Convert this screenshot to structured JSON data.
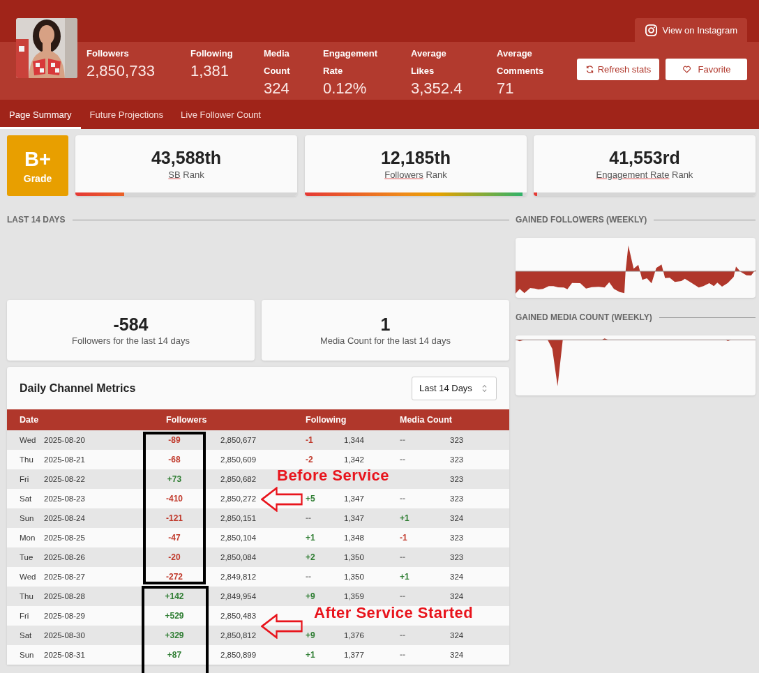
{
  "stats": [
    {
      "label": "Followers",
      "value": "2,850,733"
    },
    {
      "label": "Following",
      "value": "1,381"
    },
    {
      "label": "Media Count",
      "value": "324"
    },
    {
      "label": "Engagement Rate",
      "value": "0.12%"
    },
    {
      "label": "Average Likes",
      "value": "3,352.4"
    },
    {
      "label": "Average Comments",
      "value": "71"
    }
  ],
  "view_button": "View on Instagram",
  "buttons": [
    {
      "kind": "refresh",
      "label": "Refresh stats"
    },
    {
      "kind": "favorite",
      "label": "Favorite"
    }
  ],
  "tabs": [
    {
      "label": "Page Summary",
      "selected": true
    },
    {
      "label": "Future Projections",
      "selected": false
    },
    {
      "label": "Live Follower Count",
      "selected": false
    }
  ],
  "grade": {
    "value": "B+",
    "label": "Grade"
  },
  "ranks": [
    {
      "value": "43,588th",
      "term": "SB",
      "suffix": "Rank",
      "level": 0.22
    },
    {
      "value": "12,185th",
      "term": "Followers",
      "suffix": "Rank",
      "level": 0.98
    },
    {
      "value": "41,553rd",
      "term": "Engagement Rate",
      "suffix": "Rank",
      "level": 0.015
    }
  ],
  "last_14_days": {
    "title": "LAST 14 DAYS",
    "summaries": [
      {
        "value": "-584",
        "label": "Followers for the last 14 days"
      },
      {
        "value": "1",
        "label": "Media Count for the last 14 days"
      }
    ]
  },
  "metrics": {
    "title": "Daily Channel Metrics",
    "range": "Last 14 Days",
    "columns": [
      "Date",
      "Followers",
      "Following",
      "Media Count"
    ],
    "rows": [
      {
        "day": "Wed",
        "date": "2025-08-20",
        "followers": {
          "change": "-89",
          "color": "#c0392b",
          "total": "2,850,677"
        },
        "following": {
          "change": "-1",
          "color": "#c0392b",
          "total": "1,344"
        },
        "media_count": {
          "change": "--",
          "color": "#8a8a8a",
          "total": "323"
        }
      },
      {
        "day": "Thu",
        "date": "2025-08-21",
        "followers": {
          "change": "-68",
          "color": "#c0392b",
          "total": "2,850,609"
        },
        "following": {
          "change": "-2",
          "color": "#c0392b",
          "total": "1,342"
        },
        "media_count": {
          "change": "--",
          "color": "#8a8a8a",
          "total": "323"
        }
      },
      {
        "day": "Fri",
        "date": "2025-08-22",
        "followers": {
          "change": "+73",
          "color": "#2e7d32",
          "total": "2,850,682"
        },
        "media_count": {
          "total": "323"
        }
      },
      {
        "day": "Sat",
        "date": "2025-08-23",
        "followers": {
          "change": "-410",
          "color": "#c0392b",
          "total": "2,850,272"
        },
        "following": {
          "change": "+5",
          "color": "#2e7d32",
          "total": "1,347"
        },
        "media_count": {
          "change": "--",
          "color": "#8a8a8a",
          "total": "323"
        }
      },
      {
        "day": "Sun",
        "date": "2025-08-24",
        "followers": {
          "change": "-121",
          "color": "#c0392b",
          "total": "2,850,151"
        },
        "following": {
          "change": "--",
          "color": "#8a8a8a",
          "total": "1,347"
        },
        "media_count": {
          "change": "+1",
          "color": "#2e7d32",
          "total": "324"
        }
      },
      {
        "day": "Mon",
        "date": "2025-08-25",
        "followers": {
          "change": "-47",
          "color": "#c0392b",
          "total": "2,850,104"
        },
        "following": {
          "change": "+1",
          "color": "#2e7d32",
          "total": "1,348"
        },
        "media_count": {
          "change": "-1",
          "color": "#c0392b",
          "total": "323"
        }
      },
      {
        "day": "Tue",
        "date": "2025-08-26",
        "followers": {
          "change": "-20",
          "color": "#c0392b",
          "total": "2,850,084"
        },
        "following": {
          "change": "+2",
          "color": "#2e7d32",
          "total": "1,350"
        },
        "media_count": {
          "change": "--",
          "color": "#8a8a8a",
          "total": "323"
        }
      },
      {
        "day": "Wed",
        "date": "2025-08-27",
        "followers": {
          "change": "-272",
          "color": "#c0392b",
          "total": "2,849,812"
        },
        "following": {
          "change": "--",
          "color": "#8a8a8a",
          "total": "1,350"
        },
        "media_count": {
          "change": "+1",
          "color": "#2e7d32",
          "total": "324"
        }
      },
      {
        "day": "Thu",
        "date": "2025-08-28",
        "followers": {
          "change": "+142",
          "color": "#2e7d32",
          "total": "2,849,954"
        },
        "following": {
          "change": "+9",
          "color": "#2e7d32",
          "total": "1,359"
        },
        "media_count": {
          "change": "--",
          "color": "#8a8a8a",
          "total": "324"
        }
      },
      {
        "day": "Fri",
        "date": "2025-08-29",
        "followers": {
          "change": "+529",
          "color": "#2e7d32",
          "total": "2,850,483"
        }
      },
      {
        "day": "Sat",
        "date": "2025-08-30",
        "followers": {
          "change": "+329",
          "color": "#2e7d32",
          "total": "2,850,812"
        },
        "following": {
          "change": "+9",
          "color": "#2e7d32",
          "total": "1,376"
        },
        "media_count": {
          "change": "--",
          "color": "#8a8a8a",
          "total": "324"
        }
      },
      {
        "day": "Sun",
        "date": "2025-08-31",
        "followers": {
          "change": "+87",
          "color": "#2e7d32",
          "total": "2,850,899"
        },
        "following": {
          "change": "+1",
          "color": "#2e7d32",
          "total": "1,377"
        },
        "media_count": {
          "change": "--",
          "color": "#8a8a8a",
          "total": "324"
        }
      }
    ]
  },
  "weekly": [
    {
      "kind": "followers",
      "title": "GAINED FOLLOWERS (WEEKLY)"
    },
    {
      "kind": "media",
      "title": "GAINED MEDIA COUNT (WEEKLY)"
    }
  ],
  "annotations": [
    {
      "kind": "callout",
      "text": "Before Service"
    },
    {
      "kind": "callout",
      "text": "After Service Started"
    }
  ]
}
